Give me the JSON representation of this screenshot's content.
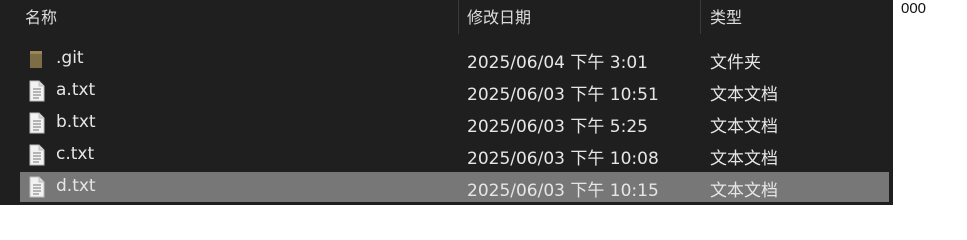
{
  "header": {
    "name_col": "名称",
    "date_col": "修改日期",
    "type_col": "类型"
  },
  "files": [
    {
      "name": ".git",
      "modified": "2025/06/04 下午 3:01",
      "type": "文件夹",
      "icon": "folder-icon"
    },
    {
      "name": "a.txt",
      "modified": "2025/06/03 下午 10:51",
      "type": "文本文档",
      "icon": "text-file-icon"
    },
    {
      "name": "b.txt",
      "modified": "2025/06/03 下午 5:25",
      "type": "文本文档",
      "icon": "text-file-icon"
    },
    {
      "name": "c.txt",
      "modified": "2025/06/03 下午 10:08",
      "type": "文本文档",
      "icon": "text-file-icon"
    },
    {
      "name": "d.txt",
      "modified": "2025/06/03 下午 10:15",
      "type": "文本文档",
      "icon": "text-file-icon",
      "selected": true
    }
  ],
  "side_label": "000",
  "colors": {
    "background": "#1f1f1f",
    "selected_row": "#777777",
    "folder": "#8c7a4a"
  }
}
